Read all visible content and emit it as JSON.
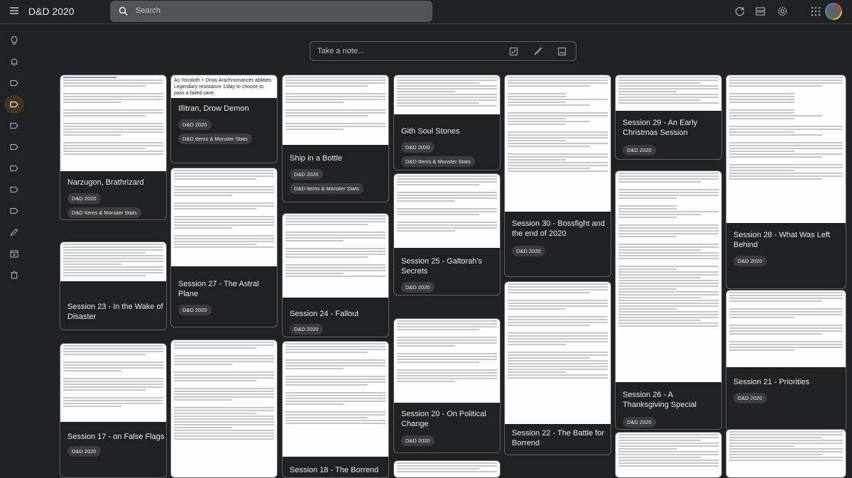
{
  "app": {
    "title": "D&D 2020"
  },
  "search": {
    "placeholder": "Search"
  },
  "take_note": {
    "placeholder": "Take a note..."
  },
  "label": "D&D 2020",
  "tag2": "D&D Items & Monster Stats",
  "notes": {
    "narzugon": {
      "title": "Narzugon, Brathrizard"
    },
    "illitran": {
      "top1": "As Yocoloth + Drow Arachnomancer abilities",
      "top2": "Legendary resistance 1/day to choose to pass a failed save",
      "title": "Illitran, Drow Demon"
    },
    "ship": {
      "title": "Ship in a Bottle"
    },
    "gith": {
      "title": "Gith Soul Stones"
    },
    "s29": {
      "title": "Session 29 - An Early Christmas Session"
    },
    "s27": {
      "title": "Session 27 - The Astral Plane"
    },
    "s30": {
      "title": "Session 30 - Bossfight and the end of 2020"
    },
    "s28": {
      "title": "Session 28 - What Was Left Behind"
    },
    "s23": {
      "title": "Session 23 - In the Wake of Disaster"
    },
    "s25": {
      "title": "Session 25 - Galtorah's Secrets"
    },
    "s24": {
      "title": "Session 24 - Fallout"
    },
    "s21": {
      "title": "Session 21 - Priorities"
    },
    "s26": {
      "title": "Session 26 - A Thanksgiving Special"
    },
    "s17": {
      "title": "Session 17 - on False Flags"
    },
    "s20": {
      "title": "Session 20 - On Political Change"
    },
    "s22": {
      "title": "Session 22 - The Battle for Borrend"
    },
    "s18": {
      "title": "Session 18 - The Borrend"
    }
  },
  "colors": {
    "background": "#202124",
    "active_label": "#41331c",
    "card_border": "#5f6368",
    "chip": "#3c3c3e"
  }
}
